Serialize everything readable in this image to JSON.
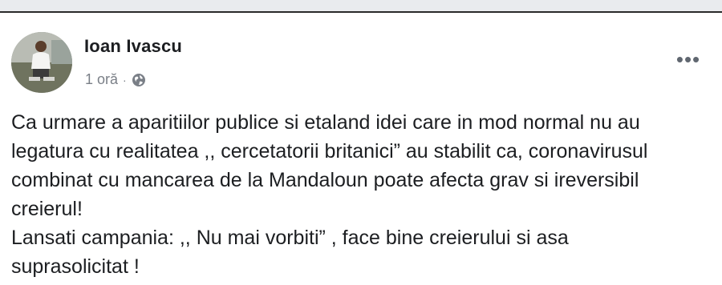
{
  "post": {
    "author": "Ioan Ivascu",
    "timestamp": "1 oră",
    "separator": "·",
    "privacy_icon": "globe-icon",
    "more_options_icon": "more-horizontal-icon",
    "more_options_label": "•••",
    "lines": [
      "Ca urmare a aparitiilor publice si etaland idei care in mod normal nu au",
      "legatura cu realitatea ,, cercetatorii britanici” au stabilit ca, coronavirusul",
      "combinat cu mancarea de la Mandaloun poate afecta grav si ireversibil",
      "creierul!",
      "Lansati campania: ,, Nu mai vorbiti” , face bine creierului si asa",
      "suprasolicitat !"
    ]
  },
  "colors": {
    "text": "#1c1e21",
    "meta": "#7a7f87",
    "top_bar": "#e9ebee"
  }
}
